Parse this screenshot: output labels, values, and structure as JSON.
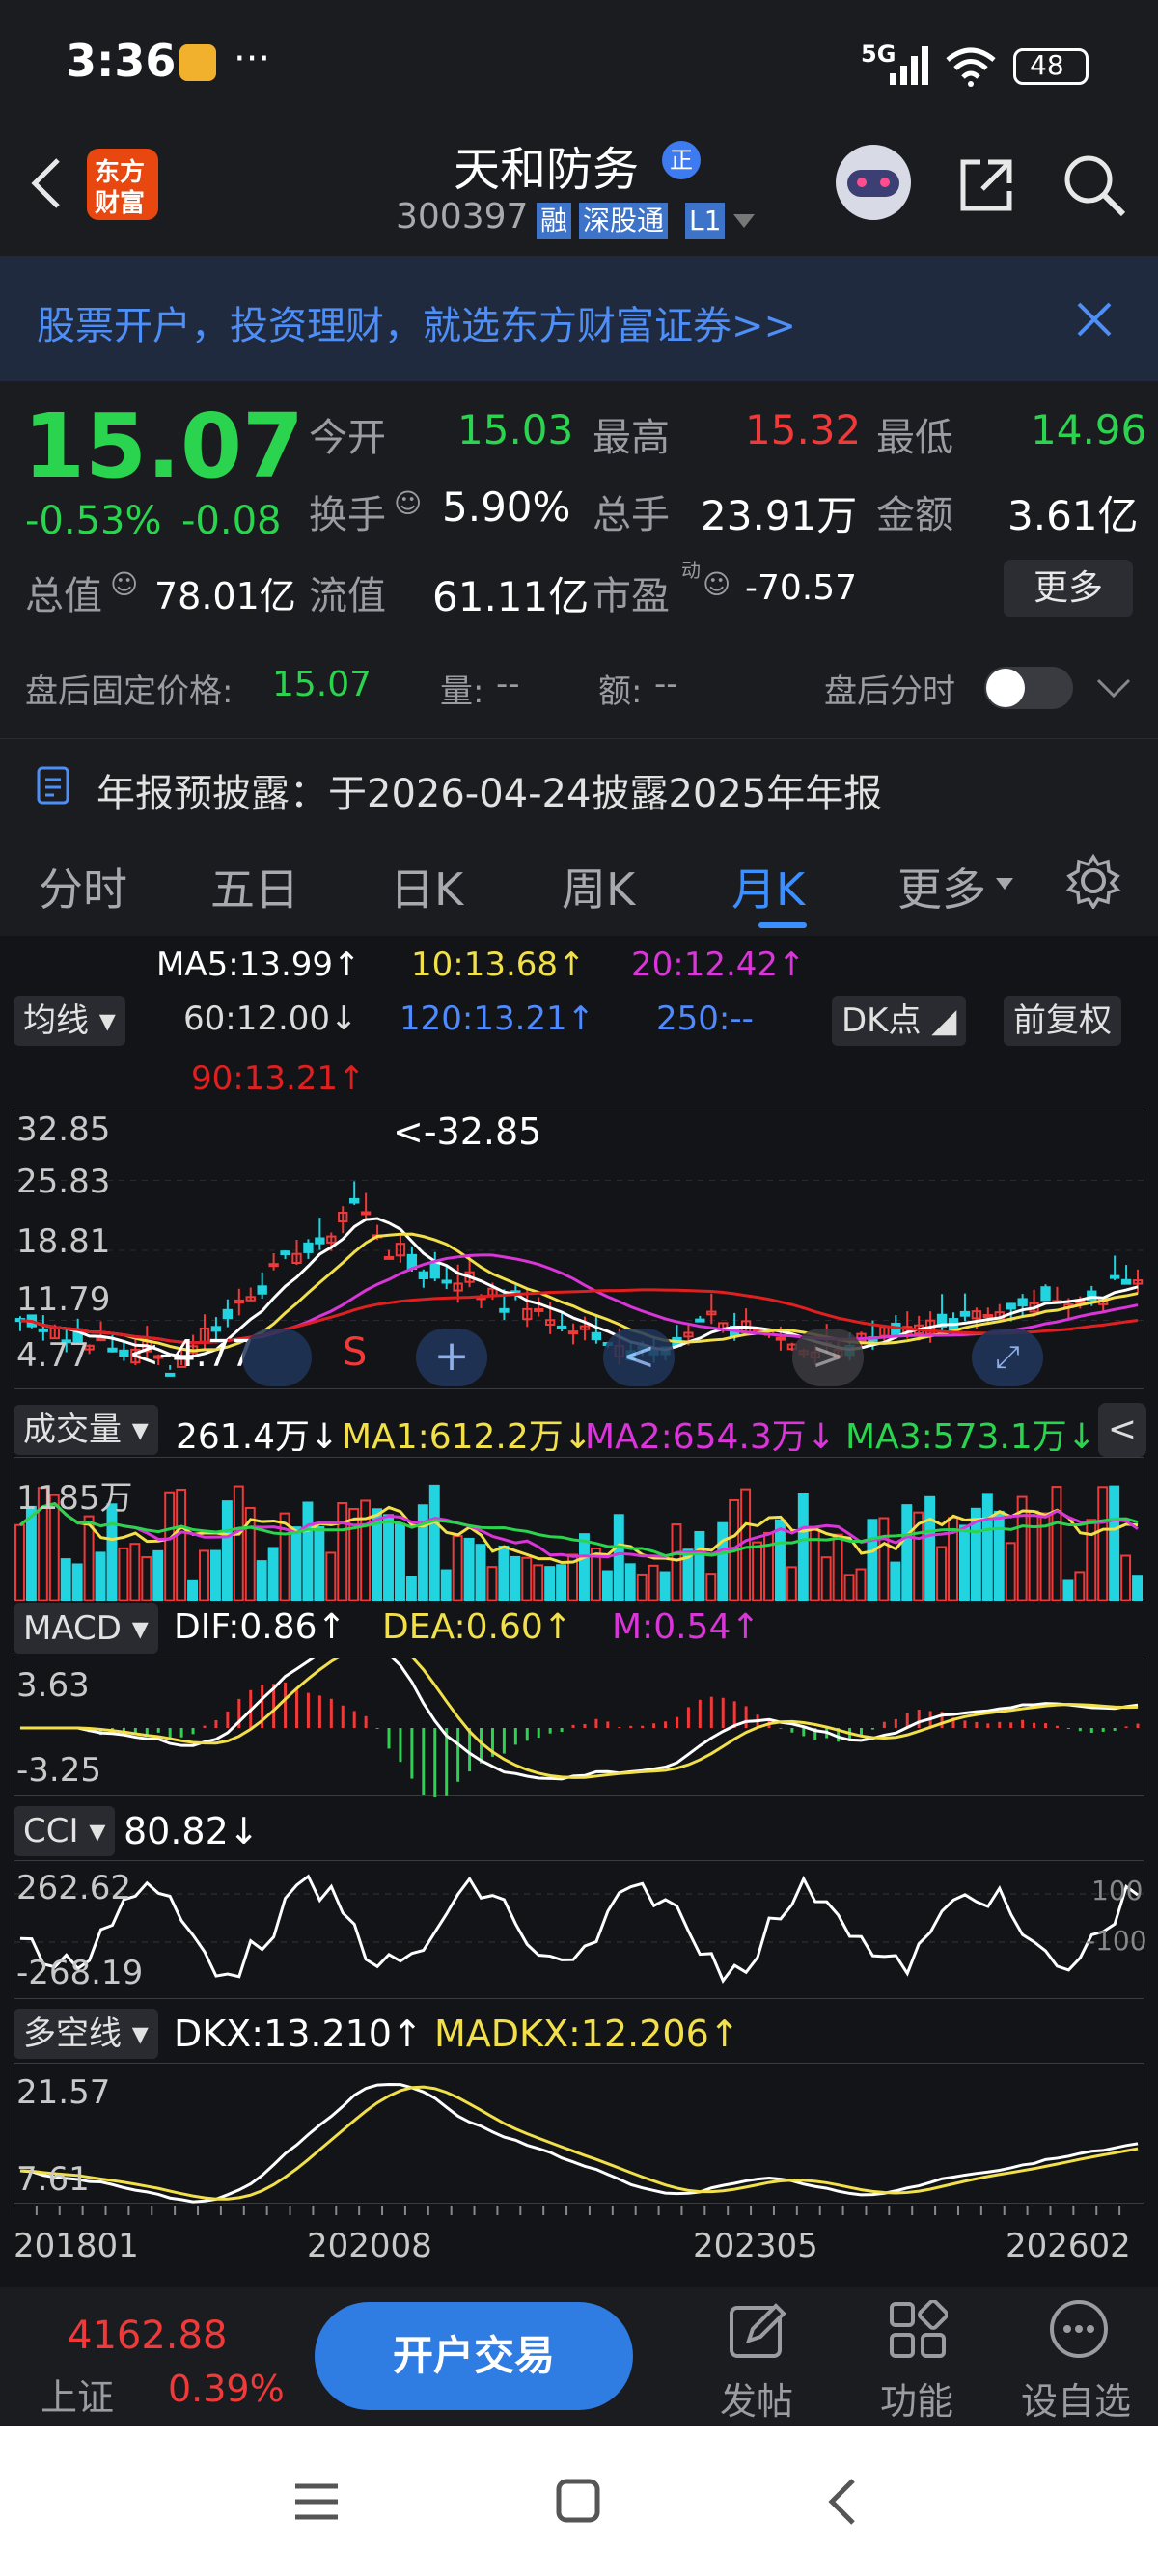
{
  "status": {
    "time": "3:36",
    "dots": "···",
    "network": "5G",
    "battery": "48"
  },
  "header": {
    "logo_line1": "东方",
    "logo_line2": "财富",
    "stock_name": "天和防务",
    "stock_code": "300397",
    "tag_margin": "融",
    "tag_connect": "深股通",
    "tag_level": "L1"
  },
  "banner": {
    "text": "股票开户，投资理财，就选东方财富证券>>"
  },
  "quote": {
    "price": "15.07",
    "change_pct": "-0.53%",
    "change": "-0.08",
    "open_label": "今开",
    "open": "15.03",
    "high_label": "最高",
    "high": "15.32",
    "low_label": "最低",
    "low": "14.96",
    "turnover_label": "换手",
    "turnover": "5.90%",
    "volume_label": "总手",
    "volume": "23.91万",
    "amount_label": "金额",
    "amount": "3.61亿",
    "mktcap_label": "总值",
    "mktcap": "78.01亿",
    "float_label": "流值",
    "float_cap": "61.11亿",
    "pe_label": "市盈",
    "pe_sup": "动",
    "pe": "-70.57",
    "more_button": "更多",
    "after_label": "盘后固定价格:",
    "after_price": "15.07",
    "after_vol_label": "量:",
    "after_vol": "--",
    "after_amt_label": "额:",
    "after_amt": "--",
    "after_timeshare": "盘后分时",
    "announce": "年报预披露：于2026-04-24披露2025年年报"
  },
  "tabs": [
    "分时",
    "五日",
    "日K",
    "周K",
    "月K",
    "更多"
  ],
  "tabs_active": 4,
  "chart": {
    "ma_button": "均线",
    "ma5": "MA5:13.99↑",
    "ma10": "10:13.68↑",
    "ma20": "20:12.42↑",
    "ma60": "60:12.00↓",
    "ma120": "120:13.21↑",
    "ma250": "250:--",
    "ma90": "90:13.21↑",
    "dk_button": "DK点",
    "adj_button": "前复权",
    "price_ticks": [
      "32.85",
      "25.83",
      "18.81",
      "11.79",
      "4.77"
    ],
    "high_marker": "<-32.85",
    "low_marker": "<-4.77",
    "s_marker": "S",
    "vol_button": "成交量",
    "vol_value": "261.4万↓",
    "vol_ma1": "MA1:612.2万↓",
    "vol_ma2": "MA2:654.3万↓",
    "vol_ma3": "MA3:573.1万↓",
    "vol_tick": "1185万",
    "macd_button": "MACD",
    "dif": "DIF:0.86↑",
    "dea": "DEA:0.60↑",
    "m": "M:0.54↑",
    "macd_ticks": [
      "3.63",
      "-3.25"
    ],
    "cci_button": "CCI",
    "cci_value": "80.82↓",
    "cci_ticks": [
      "262.62",
      "-268.19"
    ],
    "cci_right": [
      "100",
      "-100"
    ],
    "dkx_button": "多空线",
    "dkx": "DKX:13.210↑",
    "madkx": "MADKX:12.206↑",
    "dkx_ticks": [
      "21.57",
      "7.61"
    ],
    "x_labels": [
      "201801",
      "202008",
      "202305",
      "202602"
    ],
    "colors": {
      "up": "#f03a3a",
      "down": "#22d3e0",
      "ma5": "#ffffff",
      "ma10": "#f2e04a",
      "ma20": "#d935d9",
      "ma60": "#dcdcdc",
      "ma120": "#4f8bff",
      "ma90": "#e02020"
    }
  },
  "bottom": {
    "index_value": "4162.88",
    "index_name": "上证",
    "index_pct": "0.39%",
    "trade_button": "开户交易",
    "post": "发帖",
    "func": "功能",
    "watch": "设自选"
  }
}
